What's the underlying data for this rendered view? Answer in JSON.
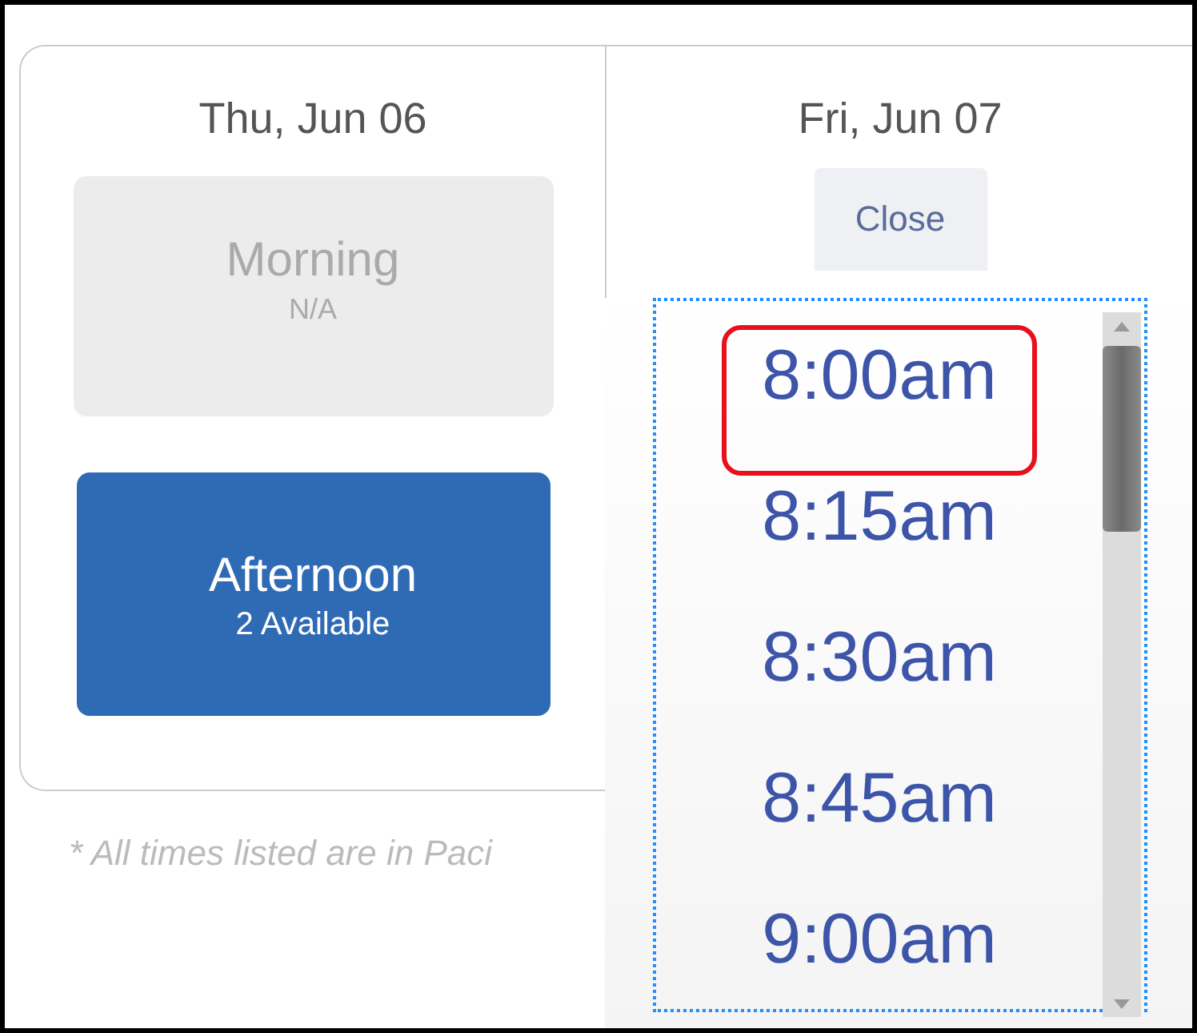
{
  "days": [
    {
      "date": "Thu, Jun 06",
      "slots": [
        {
          "label": "Morning",
          "sublabel": "N/A",
          "available": false
        },
        {
          "label": "Afternoon",
          "sublabel": "2 Available",
          "available": true
        }
      ]
    },
    {
      "date": "Fri, Jun 07",
      "close_button": "Close"
    }
  ],
  "time_list": [
    {
      "label": "8:00am",
      "highlighted": true
    },
    {
      "label": "8:15am",
      "highlighted": false
    },
    {
      "label": "8:30am",
      "highlighted": false
    },
    {
      "label": "8:45am",
      "highlighted": false
    },
    {
      "label": "9:00am",
      "highlighted": false
    }
  ],
  "note": "* All times listed are in Paci"
}
